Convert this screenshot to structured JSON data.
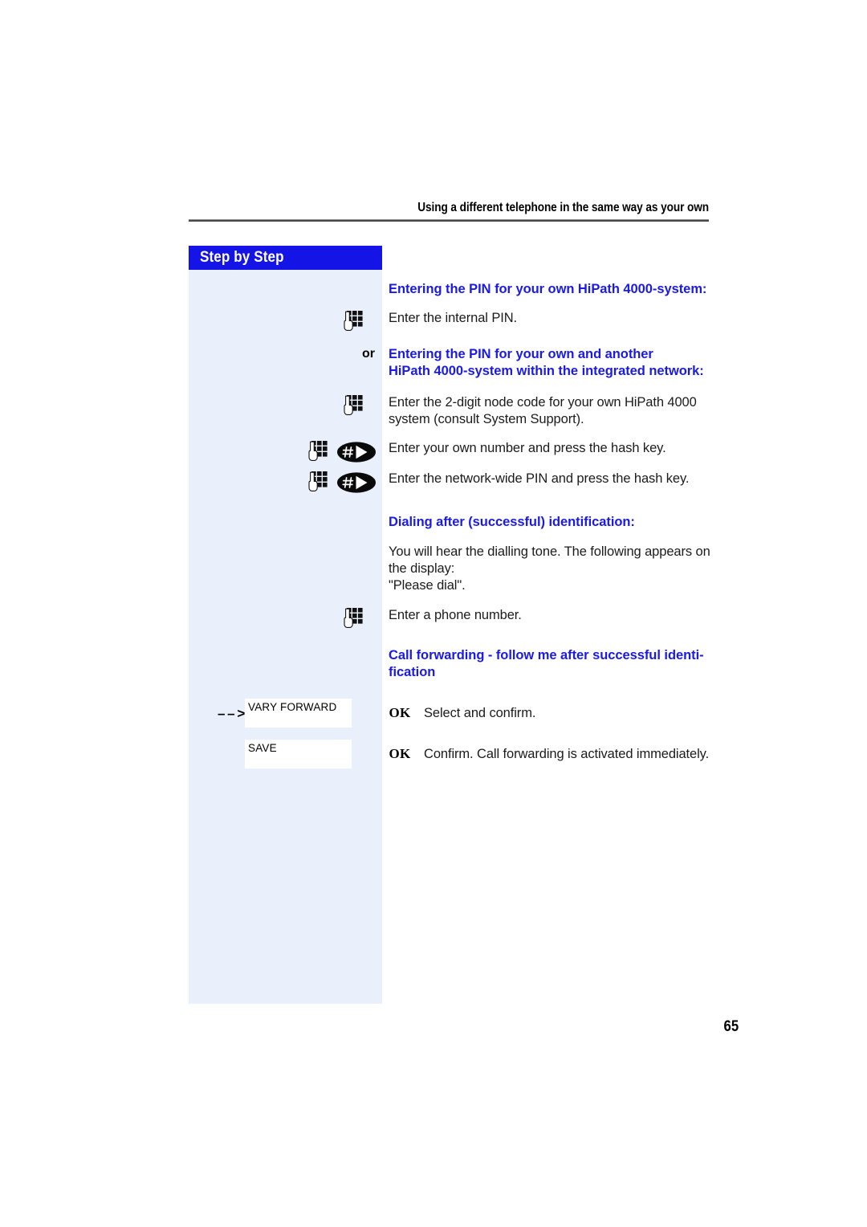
{
  "header": {
    "title": "Using a different telephone in the same way as your own"
  },
  "sidebar": {
    "bar_label": "Step by Step",
    "or_label": "or"
  },
  "page_number": "65",
  "sections": [
    {
      "kind": "heading",
      "icon": "none",
      "text": "Entering the PIN for your own HiPath 4000-system:"
    },
    {
      "kind": "instruction",
      "icon": "keypad-icon",
      "text": "Enter the internal PIN."
    },
    {
      "kind": "heading-or",
      "icon": "or",
      "text": "Entering the PIN for your own and another HiPath 4000-system within the integrated network:"
    },
    {
      "kind": "instruction",
      "icon": "keypad-icon",
      "text": "Enter the 2-digit node code for your own HiPath 4000 system (consult System Support)."
    },
    {
      "kind": "instruction",
      "icon": "keypad-hashkey-icon",
      "text": "Enter your own number and press the hash key."
    },
    {
      "kind": "instruction",
      "icon": "keypad-hashkey-icon",
      "text": "Enter the network-wide PIN and press the hash key."
    },
    {
      "kind": "heading",
      "icon": "none",
      "text": "Dialing after (successful) identification:"
    },
    {
      "kind": "instruction",
      "icon": "none",
      "text": "You will hear the dialling tone. The following appears on the display:\n\"Please dial\"."
    },
    {
      "kind": "instruction",
      "icon": "keypad-icon",
      "text": "Enter a phone number."
    },
    {
      "kind": "heading",
      "icon": "none",
      "text": "Call forwarding - follow me after successful identi-fication"
    }
  ],
  "softkeys": [
    {
      "arrow": "– – >",
      "has_arrow": true,
      "key_label": "VARY FORWARD",
      "confirm_label": "OK",
      "text": "Select and confirm."
    },
    {
      "arrow": "– – >",
      "has_arrow": false,
      "key_label": "SAVE",
      "confirm_label": "OK",
      "text": "Confirm. Call forwarding is activated immediately."
    }
  ],
  "colors": {
    "heading_blue": "#1a1ae8",
    "bar_blue": "#1414e6",
    "panel_blue": "#e9f0fb",
    "body_text": "#1b1b1b"
  }
}
